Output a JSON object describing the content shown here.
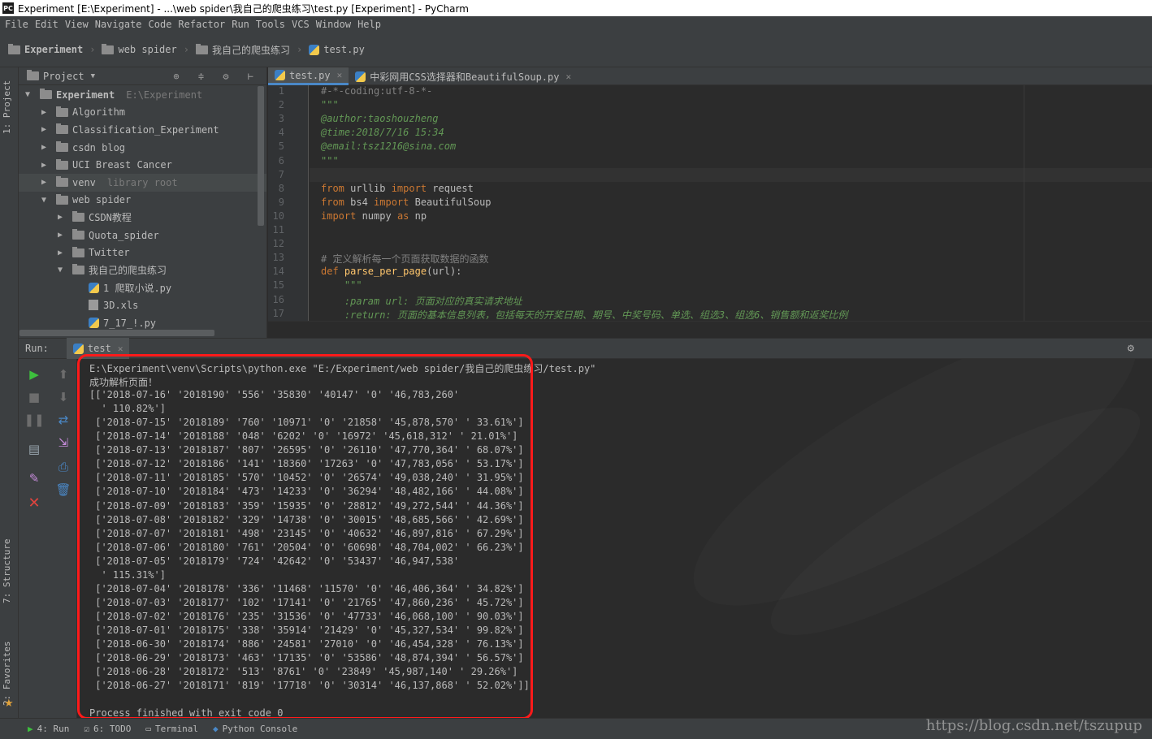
{
  "title": "Experiment [E:\\Experiment] - ...\\web spider\\我自己的爬虫练习\\test.py [Experiment] - PyCharm",
  "app_icon": "PC",
  "menu": [
    "File",
    "Edit",
    "View",
    "Navigate",
    "Code",
    "Refactor",
    "Run",
    "Tools",
    "VCS",
    "Window",
    "Help"
  ],
  "breadcrumbs": [
    "Experiment",
    "web spider",
    "我自己的爬虫练习",
    "test.py"
  ],
  "project_panel": {
    "title": "Project",
    "tree": [
      {
        "label": "Experiment",
        "extra": "E:\\Experiment",
        "depth": 0,
        "expanded": true,
        "kind": "folder",
        "bold": true
      },
      {
        "label": "Algorithm",
        "depth": 1,
        "expanded": false,
        "kind": "folder"
      },
      {
        "label": "Classification_Experiment",
        "depth": 1,
        "expanded": false,
        "kind": "folder"
      },
      {
        "label": "csdn blog",
        "depth": 1,
        "expanded": false,
        "kind": "folder"
      },
      {
        "label": "UCI Breast Cancer",
        "depth": 1,
        "expanded": false,
        "kind": "folder"
      },
      {
        "label": "venv",
        "extra": "library root",
        "depth": 1,
        "expanded": false,
        "kind": "folder",
        "highlight": true
      },
      {
        "label": "web spider",
        "depth": 1,
        "expanded": true,
        "kind": "folder"
      },
      {
        "label": "CSDN教程",
        "depth": 2,
        "expanded": false,
        "kind": "folder"
      },
      {
        "label": "Quota_spider",
        "depth": 2,
        "expanded": false,
        "kind": "folder"
      },
      {
        "label": "Twitter",
        "depth": 2,
        "expanded": false,
        "kind": "folder"
      },
      {
        "label": "我自己的爬虫练习",
        "depth": 2,
        "expanded": true,
        "kind": "folder"
      },
      {
        "label": "1 爬取小说.py",
        "depth": 3,
        "kind": "py"
      },
      {
        "label": "3D.xls",
        "depth": 3,
        "kind": "xls"
      },
      {
        "label": "7_17_!.py",
        "depth": 3,
        "kind": "py"
      }
    ]
  },
  "editor_tabs": [
    {
      "label": "test.py",
      "active": true
    },
    {
      "label": "中彩网用CSS选择器和BeautifulSoup.py",
      "active": false
    }
  ],
  "code_lines": [
    {
      "n": "1",
      "parts": [
        [
          "cm",
          "#-*-coding:utf-8-*-"
        ]
      ]
    },
    {
      "n": "2",
      "parts": [
        [
          "doc",
          "\"\"\""
        ]
      ]
    },
    {
      "n": "3",
      "parts": [
        [
          "doc",
          "@author:taoshouzheng"
        ]
      ]
    },
    {
      "n": "4",
      "parts": [
        [
          "doc",
          "@time:2018/7/16 15:34"
        ]
      ]
    },
    {
      "n": "5",
      "parts": [
        [
          "doc",
          "@email:tsz1216@sina.com"
        ]
      ]
    },
    {
      "n": "6",
      "parts": [
        [
          "doc",
          "\"\"\""
        ]
      ]
    },
    {
      "n": "7",
      "parts": []
    },
    {
      "n": "8",
      "parts": [
        [
          "kw",
          "from "
        ],
        [
          "pl",
          "urllib "
        ],
        [
          "kw",
          "import "
        ],
        [
          "pl",
          "request"
        ]
      ]
    },
    {
      "n": "9",
      "parts": [
        [
          "kw",
          "from "
        ],
        [
          "pl",
          "bs4 "
        ],
        [
          "kw",
          "import "
        ],
        [
          "pl",
          "BeautifulSoup"
        ]
      ]
    },
    {
      "n": "10",
      "parts": [
        [
          "kw",
          "import "
        ],
        [
          "pl",
          "numpy "
        ],
        [
          "kw",
          "as "
        ],
        [
          "pl",
          "np"
        ]
      ]
    },
    {
      "n": "11",
      "parts": []
    },
    {
      "n": "12",
      "parts": []
    },
    {
      "n": "13",
      "parts": [
        [
          "cm",
          "# 定义解析每一个页面获取数据的函数"
        ]
      ]
    },
    {
      "n": "14",
      "parts": [
        [
          "kw",
          "def "
        ],
        [
          "fn",
          "parse_per_page"
        ],
        [
          "pl",
          "(url):"
        ]
      ]
    },
    {
      "n": "15",
      "parts": [
        [
          "doc",
          "    \"\"\""
        ]
      ]
    },
    {
      "n": "16",
      "parts": [
        [
          "doc",
          "    :param url: 页面对应的真实请求地址"
        ]
      ]
    },
    {
      "n": "17",
      "parts": [
        [
          "doc",
          "    :return: 页面的基本信息列表，包括每天的开奖日期、期号、中奖号码、单选、组选3、组选6、销售额和返奖比例"
        ]
      ]
    }
  ],
  "run_panel": {
    "label": "Run:",
    "tab": "test"
  },
  "console_lines": [
    "E:\\Experiment\\venv\\Scripts\\python.exe \"E:/Experiment/web spider/我自己的爬虫练习/test.py\"",
    "成功解析页面！",
    "[['2018-07-16' '2018190' '556' '35830' '40147' '0' '46,783,260'",
    "  ' 110.82%']",
    " ['2018-07-15' '2018189' '760' '10971' '0' '21858' '45,878,570' ' 33.61%']",
    " ['2018-07-14' '2018188' '048' '6202' '0' '16972' '45,618,312' ' 21.01%']",
    " ['2018-07-13' '2018187' '807' '26595' '0' '26110' '47,770,364' ' 68.07%']",
    " ['2018-07-12' '2018186' '141' '18360' '17263' '0' '47,783,056' ' 53.17%']",
    " ['2018-07-11' '2018185' '570' '10452' '0' '26574' '49,038,240' ' 31.95%']",
    " ['2018-07-10' '2018184' '473' '14233' '0' '36294' '48,482,166' ' 44.08%']",
    " ['2018-07-09' '2018183' '359' '15935' '0' '28812' '49,272,544' ' 44.36%']",
    " ['2018-07-08' '2018182' '329' '14738' '0' '30015' '48,685,566' ' 42.69%']",
    " ['2018-07-07' '2018181' '498' '23145' '0' '40632' '46,897,816' ' 67.29%']",
    " ['2018-07-06' '2018180' '761' '20504' '0' '60698' '48,704,002' ' 66.23%']",
    " ['2018-07-05' '2018179' '724' '42642' '0' '53437' '46,947,538'",
    "  ' 115.31%']",
    " ['2018-07-04' '2018178' '336' '11468' '11570' '0' '46,406,364' ' 34.82%']",
    " ['2018-07-03' '2018177' '102' '17141' '0' '21765' '47,860,236' ' 45.72%']",
    " ['2018-07-02' '2018176' '235' '31536' '0' '47733' '46,068,100' ' 90.03%']",
    " ['2018-07-01' '2018175' '338' '35914' '21429' '0' '45,327,534' ' 99.82%']",
    " ['2018-06-30' '2018174' '886' '24581' '27010' '0' '46,454,328' ' 76.13%']",
    " ['2018-06-29' '2018173' '463' '17135' '0' '53586' '48,874,394' ' 56.57%']",
    " ['2018-06-28' '2018172' '513' '8761' '0' '23849' '45,987,140' ' 29.26%']",
    " ['2018-06-27' '2018171' '819' '17718' '0' '30314' '46,137,868' ' 52.02%']]",
    "",
    "Process finished with exit code 0"
  ],
  "side_tabs": {
    "project": "1: Project",
    "structure": "7: Structure",
    "favorites": "2: Favorites"
  },
  "status_tabs": [
    {
      "label": "4: Run",
      "icon": "run-icon"
    },
    {
      "label": "6: TODO",
      "icon": "todo-icon"
    },
    {
      "label": "Terminal",
      "icon": "terminal-icon"
    },
    {
      "label": "Python Console",
      "icon": "python-console-icon"
    }
  ],
  "watermark": "https://blog.csdn.net/tszupup",
  "colors": {
    "highlight_box": "#ff1a1a",
    "keyword": "#cc7832",
    "docstring": "#629755",
    "comment": "#808080",
    "function": "#ffc66d",
    "run_green": "#3dbf3d",
    "stop_red": "#e0443e"
  }
}
